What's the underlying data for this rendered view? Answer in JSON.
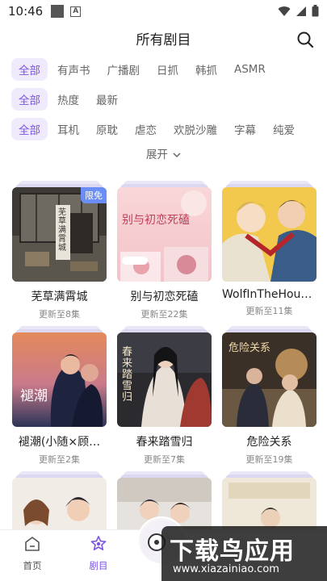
{
  "status": {
    "time": "10:46"
  },
  "header": {
    "title": "所有剧目"
  },
  "filters": {
    "row1": [
      "全部",
      "有声书",
      "广播剧",
      "日抓",
      "韩抓",
      "ASMR"
    ],
    "row2": [
      "全部",
      "热度",
      "最新"
    ],
    "row3": [
      "全部",
      "耳机",
      "原耽",
      "虐恋",
      "欢脱沙雕",
      "字幕",
      "纯爱"
    ],
    "expand": "展开"
  },
  "cards": [
    {
      "title": "芜草满霄城",
      "subtitle": "更新至8集",
      "badge": "限免",
      "cover_text": "芜草满霄城"
    },
    {
      "title": "别与初恋死磕",
      "subtitle": "更新至22集",
      "cover_text": "别与初恋死磕"
    },
    {
      "title": "WolfInTheHous…",
      "subtitle": "更新至11集"
    },
    {
      "title": "褪潮(小随×顾…",
      "subtitle": "更新至2集",
      "cover_text": "褪潮"
    },
    {
      "title": "春来踏雪归",
      "subtitle": "更新至7集",
      "cover_text": "春来踏雪归"
    },
    {
      "title": "危险关系",
      "subtitle": "更新至19集",
      "cover_text": "危险关系"
    }
  ],
  "tabbar": {
    "home": "首页",
    "programs": "剧目"
  },
  "watermark": {
    "main": "下载鸟应用",
    "url": "www.xiazainiao.com"
  }
}
